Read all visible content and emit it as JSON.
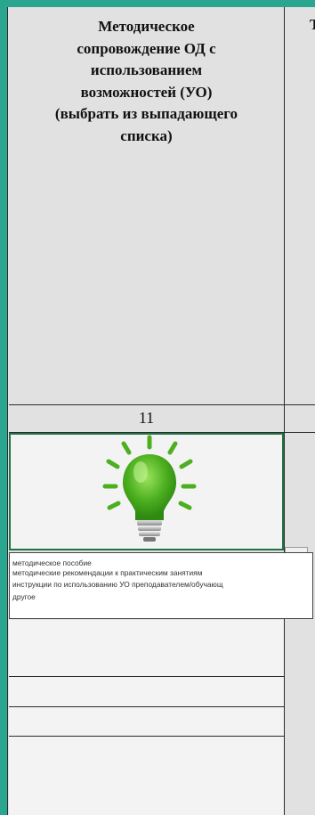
{
  "header": {
    "lines": [
      "Методическое",
      "сопровождение ОД с",
      "использованием",
      "возможностей (УО)",
      "(выбрать из выпадающего",
      "списка)"
    ],
    "next_column_letter": "Т"
  },
  "column_number": "11",
  "icon": "lightbulb-icon",
  "dropdown": {
    "options": [
      "методическое пособие",
      "методические рекомендации к практическим занятиям",
      "инструкции по использованию УО преподавателем/обучающ",
      "другое"
    ]
  },
  "colors": {
    "background": "#2aa58f",
    "cell": "#e1e1e1",
    "selection_border": "#217346",
    "bulb": "#4caf1f"
  }
}
